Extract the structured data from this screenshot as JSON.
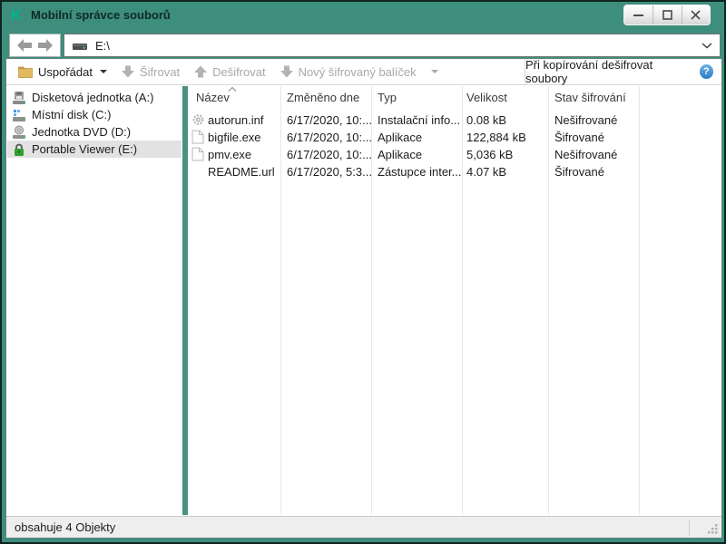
{
  "titlebar": {
    "title": "Mobilní správce souborů",
    "logo": "K"
  },
  "navbar": {
    "address": "E:\\"
  },
  "toolbar": {
    "organize_label": "Uspořádat",
    "encrypt_label": "Šifrovat",
    "decrypt_label": "Dešifrovat",
    "new_package_label": "Nový šifrovaný balíček",
    "copy_decrypt_label": "Při kopírování dešifrovat soubory",
    "help_glyph": "?"
  },
  "sidebar": {
    "items": [
      {
        "label": "Disketová jednotka (A:)",
        "icon": "floppy-drive-icon",
        "selected": false
      },
      {
        "label": "Místní disk (C:)",
        "icon": "hard-drive-icon",
        "selected": false
      },
      {
        "label": "Jednotka DVD (D:)",
        "icon": "dvd-drive-icon",
        "selected": false
      },
      {
        "label": "Portable Viewer (E:)",
        "icon": "lock-icon",
        "selected": true
      }
    ]
  },
  "filelist": {
    "columns": {
      "name": "Název",
      "modified": "Změněno dne",
      "type": "Typ",
      "size": "Velikost",
      "status": "Stav šifrování"
    },
    "sort_column": "Název",
    "rows": [
      {
        "name": "autorun.inf",
        "icon": "gear-file-icon",
        "modified": "6/17/2020, 10:...",
        "type": "Instalační info...",
        "size": "0.08 kB",
        "status": "Nešifrované"
      },
      {
        "name": "bigfile.exe",
        "icon": "file-icon",
        "modified": "6/17/2020, 10:...",
        "type": "Aplikace",
        "size": "122,884 kB",
        "status": "Šifrované"
      },
      {
        "name": "pmv.exe",
        "icon": "file-icon",
        "modified": "6/17/2020, 10:...",
        "type": "Aplikace",
        "size": "5,036 kB",
        "status": "Nešifrované"
      },
      {
        "name": "README.url",
        "icon": "none",
        "modified": "6/17/2020, 5:3...",
        "type": "Zástupce inter...",
        "size": "4.07 kB",
        "status": "Šifrované"
      }
    ]
  },
  "statusbar": {
    "text": "obsahuje 4 Objekty"
  },
  "colors": {
    "frame": "#3e8e7d",
    "logo_green": "#00b292",
    "splitter": "#4b9180",
    "help_blue": "#3d87cf",
    "lock_green": "#2fa02f",
    "folder_yellow": "#e3b95e",
    "selection_gray": "#e2e2e2",
    "disabled_text": "#a8a8a8"
  }
}
